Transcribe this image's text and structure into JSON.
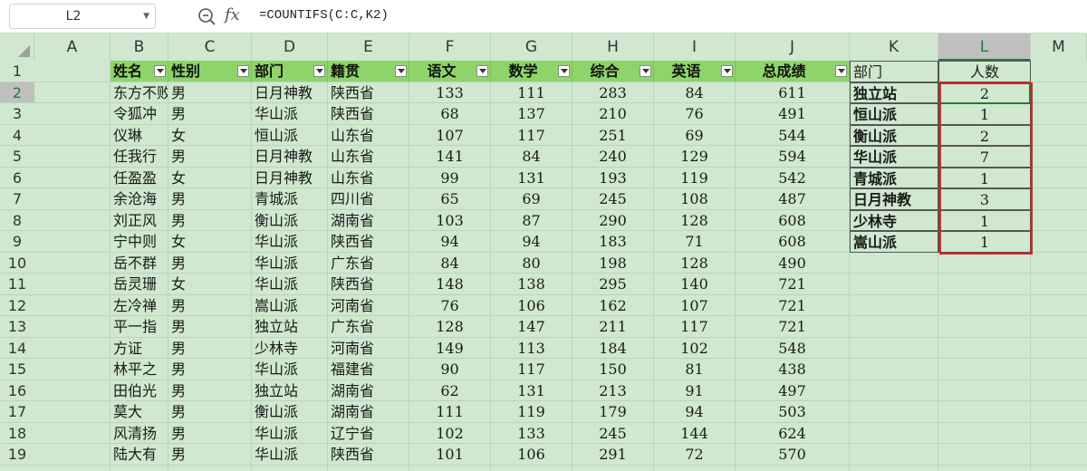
{
  "formula_bar": {
    "name_box": "L2",
    "fx_label": "fx",
    "formula": "=COUNTIFS(C:C,K2)"
  },
  "columns": [
    "A",
    "B",
    "C",
    "D",
    "E",
    "F",
    "G",
    "H",
    "I",
    "J",
    "K",
    "L",
    "M"
  ],
  "selected_column": "L",
  "row_numbers": [
    "1",
    "2",
    "3",
    "4",
    "5",
    "6",
    "7",
    "8",
    "9",
    "10",
    "11",
    "12",
    "13",
    "14",
    "15",
    "16",
    "17",
    "18",
    "19"
  ],
  "selected_row": "2",
  "colors": {
    "header_fill": "#8ed46a",
    "sheet_bg": "#cfe8cf",
    "highlight_border": "#e02020",
    "select_green": "#1e7b38"
  },
  "main_table": {
    "headers": [
      "姓名",
      "性别",
      "部门",
      "籍贯",
      "语文",
      "数学",
      "综合",
      "英语",
      "总成绩"
    ],
    "rows": [
      [
        "东方不败",
        "男",
        "日月神教",
        "陕西省",
        "133",
        "111",
        "283",
        "84",
        "611"
      ],
      [
        "令狐冲",
        "男",
        "华山派",
        "陕西省",
        "68",
        "137",
        "210",
        "76",
        "491"
      ],
      [
        "仪琳",
        "女",
        "恒山派",
        "山东省",
        "107",
        "117",
        "251",
        "69",
        "544"
      ],
      [
        "任我行",
        "男",
        "日月神教",
        "山东省",
        "141",
        "84",
        "240",
        "129",
        "594"
      ],
      [
        "任盈盈",
        "女",
        "日月神教",
        "山东省",
        "99",
        "131",
        "193",
        "119",
        "542"
      ],
      [
        "余沧海",
        "男",
        "青城派",
        "四川省",
        "65",
        "69",
        "245",
        "108",
        "487"
      ],
      [
        "刘正风",
        "男",
        "衡山派",
        "湖南省",
        "103",
        "87",
        "290",
        "128",
        "608"
      ],
      [
        "宁中则",
        "女",
        "华山派",
        "陕西省",
        "94",
        "94",
        "183",
        "71",
        "608"
      ],
      [
        "岳不群",
        "男",
        "华山派",
        "广东省",
        "84",
        "80",
        "198",
        "128",
        "490"
      ],
      [
        "岳灵珊",
        "女",
        "华山派",
        "陕西省",
        "148",
        "138",
        "295",
        "140",
        "721"
      ],
      [
        "左冷禅",
        "男",
        "嵩山派",
        "河南省",
        "76",
        "106",
        "162",
        "107",
        "721"
      ],
      [
        "平一指",
        "男",
        "独立站",
        "广东省",
        "128",
        "147",
        "211",
        "117",
        "721"
      ],
      [
        "方证",
        "男",
        "少林寺",
        "河南省",
        "149",
        "113",
        "184",
        "102",
        "548"
      ],
      [
        "林平之",
        "男",
        "华山派",
        "福建省",
        "90",
        "117",
        "150",
        "81",
        "438"
      ],
      [
        "田伯光",
        "男",
        "独立站",
        "湖南省",
        "62",
        "131",
        "213",
        "91",
        "497"
      ],
      [
        "莫大",
        "男",
        "衡山派",
        "湖南省",
        "111",
        "119",
        "179",
        "94",
        "503"
      ],
      [
        "风清扬",
        "男",
        "华山派",
        "辽宁省",
        "102",
        "133",
        "245",
        "144",
        "624"
      ],
      [
        "陆大有",
        "男",
        "华山派",
        "陕西省",
        "101",
        "106",
        "291",
        "72",
        "570"
      ]
    ]
  },
  "summary_table": {
    "headers": [
      "部门",
      "人数"
    ],
    "rows": [
      [
        "独立站",
        "2"
      ],
      [
        "恒山派",
        "1"
      ],
      [
        "衡山派",
        "2"
      ],
      [
        "华山派",
        "7"
      ],
      [
        "青城派",
        "1"
      ],
      [
        "日月神教",
        "3"
      ],
      [
        "少林寺",
        "1"
      ],
      [
        "嵩山派",
        "1"
      ]
    ]
  }
}
